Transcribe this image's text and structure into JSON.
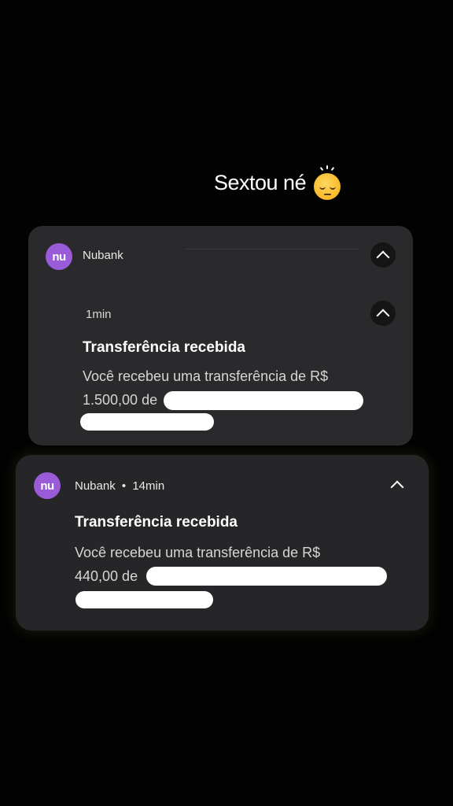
{
  "caption": {
    "text": "Sextou né",
    "emoji": "pensive-face-emoji"
  },
  "notifications": [
    {
      "app_name": "Nubank",
      "logo_text": "nu",
      "time": "1min",
      "title": "Transferência recebida",
      "body_line1": "Você recebeu uma transferência de R$",
      "body_amount": "1.500,00 de",
      "expanded": true
    },
    {
      "app_name": "Nubank",
      "separator": "•",
      "time": "14min",
      "logo_text": "nu",
      "title": "Transferência recebida",
      "body_line1": "Você recebeu uma transferência de R$",
      "body_amount": "440,00 de",
      "expanded": true
    }
  ],
  "icons": {
    "collapse": "chevron-up-icon",
    "logo": "nubank-logo-icon"
  },
  "colors": {
    "background": "#020202",
    "card": "#2a2a2c",
    "brand": "#9a5bd8",
    "text": "#ffffff"
  }
}
